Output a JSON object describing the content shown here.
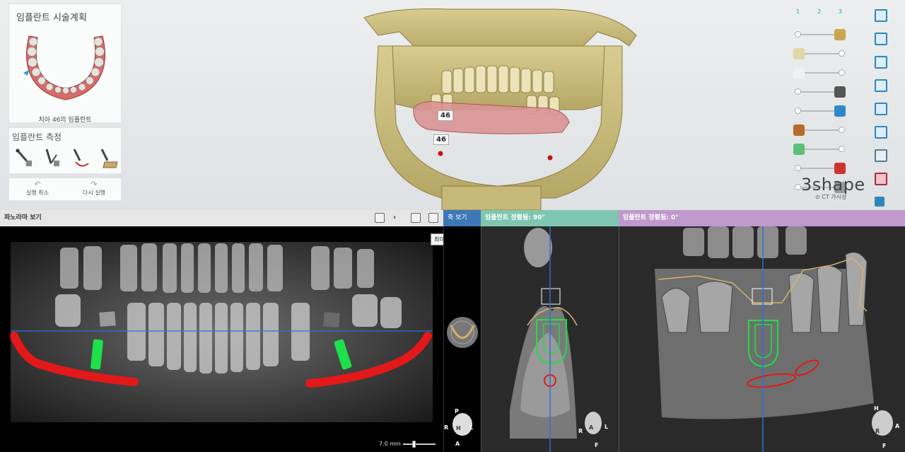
{
  "plan_panel": {
    "title": "임플란트 시술계획",
    "caption": "치아 46의 임플란트"
  },
  "measure_panel": {
    "title": "임플란트 측정",
    "tools": [
      "distance-tool",
      "angle-tool",
      "curve-distance-tool",
      "bone-density-tool"
    ]
  },
  "history": {
    "undo_label": "실행 취소",
    "redo_label": "다시 실행"
  },
  "tooth_tags": [
    "46",
    "46"
  ],
  "visibility": {
    "tabs": [
      "1",
      "2",
      "3"
    ],
    "rows": [
      {
        "name": "crown-opacity",
        "level": 0.0
      },
      {
        "name": "model-opacity",
        "level": 1.0
      },
      {
        "name": "gingiva-opacity",
        "level": 1.0
      },
      {
        "name": "abutment-opacity",
        "level": 0.0
      },
      {
        "name": "implant-opacity",
        "level": 0.0
      },
      {
        "name": "sleeve-opacity",
        "level": 1.0
      },
      {
        "name": "guide-opacity",
        "level": 1.0
      },
      {
        "name": "nerve-opacity",
        "level": 0.0
      },
      {
        "name": "ct-opacity",
        "level": 0.0
      }
    ],
    "ct_label": "CT 가시성"
  },
  "brand": "3shape",
  "views": {
    "panorama": {
      "title": "파노라마 보기",
      "tooltip": "최대화(E)",
      "scale": "7.0 mm"
    },
    "axial": {
      "title": "축 보기"
    },
    "cross90": {
      "title": "임플란트 정렬됨: 90°"
    },
    "cross0": {
      "title": "임플란트 정렬됨: 0°"
    }
  },
  "orientation": {
    "axial": [
      "P",
      "R",
      "H",
      "L",
      "A"
    ],
    "cross90": [
      "R",
      "A",
      "L",
      "F"
    ],
    "cross0": [
      "H",
      "R",
      "A",
      "F"
    ]
  },
  "colors": {
    "implant": "#1de04a",
    "nerve": "#e31818",
    "axis": "#2e6fdc",
    "bone_line": "#d9b16f"
  }
}
